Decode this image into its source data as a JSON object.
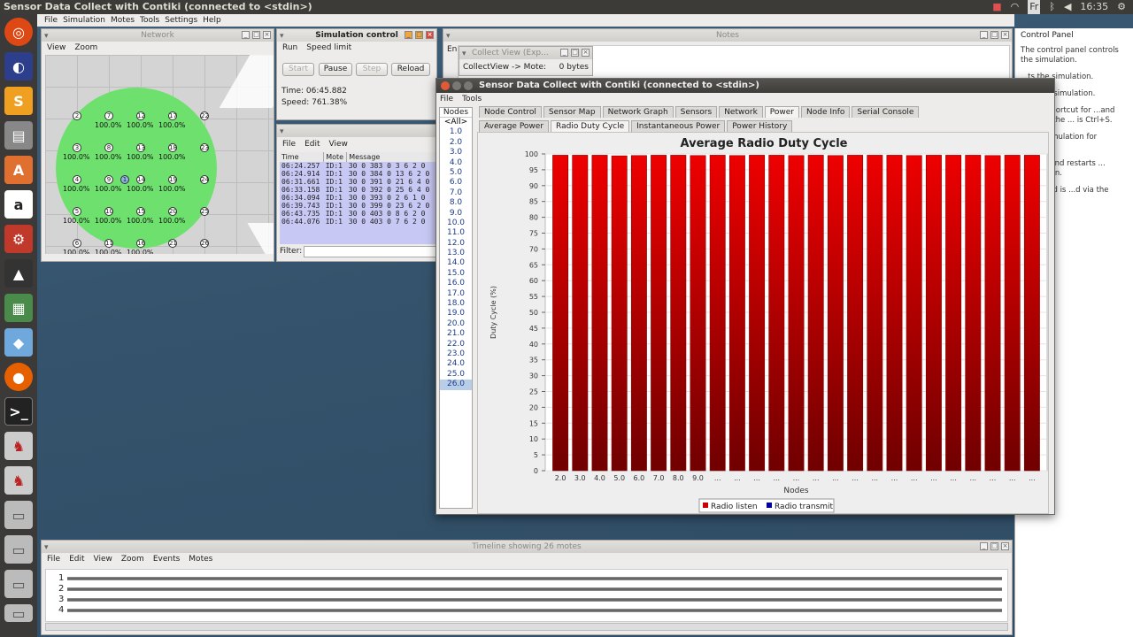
{
  "topbar": {
    "title": "Sensor Data Collect with Contiki (connected to <stdin>)",
    "keyboard": "Fr",
    "time": "16:35"
  },
  "main_menu": [
    "File",
    "Simulation",
    "Motes",
    "Tools",
    "Settings",
    "Help"
  ],
  "network": {
    "title": "Network",
    "menu": [
      "View",
      "Zoom"
    ],
    "pct": "100.0%",
    "nodes": [
      "7",
      "12",
      "17",
      "22",
      "3",
      "8",
      "13",
      "18",
      "23",
      "4",
      "9",
      "1",
      "14",
      "19",
      "24",
      "5",
      "10",
      "15",
      "20",
      "25",
      "6",
      "11",
      "16",
      "21",
      "26",
      "2"
    ]
  },
  "sim_control": {
    "title": "Simulation control",
    "menu": [
      "Run",
      "Speed limit"
    ],
    "start": "Start",
    "pause": "Pause",
    "step": "Step",
    "reload": "Reload",
    "time": "Time: 06:45.882",
    "speed": "Speed: 761.38%"
  },
  "log": {
    "menu": [
      "File",
      "Edit",
      "View"
    ],
    "headers": [
      "Time",
      "Mote",
      "Message"
    ],
    "rows": [
      [
        "06:24.257",
        "ID:1",
        "30 0 383 0 3 6 2 0"
      ],
      [
        "06:24.914",
        "ID:1",
        "30 0 384 0 13 6 2 0"
      ],
      [
        "06:31.661",
        "ID:1",
        "30 0 391 0 21 6 4 0"
      ],
      [
        "06:33.158",
        "ID:1",
        "30 0 392 0 25 6 4 0"
      ],
      [
        "06:34.094",
        "ID:1",
        "30 0 393 0 2 6 1 0"
      ],
      [
        "06:39.743",
        "ID:1",
        "30 0 399 0 23 6 2 0"
      ],
      [
        "06:43.735",
        "ID:1",
        "30 0 403 0 8 6 2 0"
      ],
      [
        "06:44.076",
        "ID:1",
        "30 0 403 0 7 6 2 0"
      ]
    ],
    "filter": "Filter:"
  },
  "notes": {
    "title": "Notes"
  },
  "collect_view": {
    "title": "Collect View (Exp...",
    "label": "CollectView -> Mote:",
    "bytes": "0 bytes",
    "menu_letter": "En"
  },
  "control_panel": {
    "title": "Control Panel",
    "lines": [
      "The control panel controls the simulation.",
      "...ts the simulation.",
      "...ps the simulation.",
      "...oard shortcut for ...and pausing the ... is Ctrl+S.",
      "... the simulation for ...econd.",
      "...loads and restarts ... simulation.",
      "...n speed is ...d via the Speed ..."
    ]
  },
  "collect": {
    "title": "Sensor Data Collect with Contiki (connected to <stdin>)",
    "menu": [
      "File",
      "Tools"
    ],
    "nodes_header": "Nodes",
    "nodes_list": [
      "<All>",
      "1.0",
      "2.0",
      "3.0",
      "4.0",
      "5.0",
      "6.0",
      "7.0",
      "8.0",
      "9.0",
      "10.0",
      "11.0",
      "12.0",
      "13.0",
      "14.0",
      "15.0",
      "16.0",
      "17.0",
      "18.0",
      "19.0",
      "20.0",
      "21.0",
      "22.0",
      "23.0",
      "24.0",
      "25.0",
      "26.0"
    ],
    "tabs": [
      "Node Control",
      "Sensor Map",
      "Network Graph",
      "Sensors",
      "Network",
      "Power",
      "Node Info",
      "Serial Console"
    ],
    "subtabs": [
      "Average Power",
      "Radio Duty Cycle",
      "Instantaneous Power",
      "Power History"
    ]
  },
  "timeline": {
    "title": "Timeline showing 26 motes",
    "menu": [
      "File",
      "Edit",
      "View",
      "Zoom",
      "Events",
      "Motes"
    ],
    "rows": [
      "1",
      "2",
      "3",
      "4"
    ]
  },
  "chart_data": {
    "type": "bar",
    "title": "Average Radio Duty Cycle",
    "xlabel": "Nodes",
    "ylabel": "Duty Cycle (%)",
    "ylim": [
      0,
      100
    ],
    "yticks": [
      0,
      5,
      10,
      15,
      20,
      25,
      30,
      35,
      40,
      45,
      50,
      55,
      60,
      65,
      70,
      75,
      80,
      85,
      90,
      95,
      100
    ],
    "categories": [
      "2.0",
      "3.0",
      "4.0",
      "5.0",
      "6.0",
      "7.0",
      "8.0",
      "9.0",
      "...",
      "...",
      "...",
      "...",
      "...",
      "...",
      "...",
      "...",
      "...",
      "...",
      "...",
      "...",
      "...",
      "...",
      "...",
      "...",
      "..."
    ],
    "series": [
      {
        "name": "Radio listen",
        "color": "#cc0000",
        "values": [
          99.6,
          99.6,
          99.6,
          99.4,
          99.5,
          99.6,
          99.6,
          99.5,
          99.6,
          99.5,
          99.6,
          99.6,
          99.5,
          99.6,
          99.5,
          99.6,
          99.6,
          99.6,
          99.5,
          99.6,
          99.6,
          99.6,
          99.5,
          99.6,
          99.6
        ]
      },
      {
        "name": "Radio transmit",
        "color": "#0000a0",
        "values": [
          0.1,
          0.1,
          0.1,
          0.1,
          0.1,
          0.1,
          0.1,
          0.1,
          0.1,
          0.1,
          0.1,
          0.1,
          0.1,
          0.1,
          0.1,
          0.1,
          0.1,
          0.1,
          0.1,
          0.1,
          0.1,
          0.1,
          0.1,
          0.1,
          0.1
        ]
      }
    ],
    "grid": true,
    "legend": "bottom"
  }
}
